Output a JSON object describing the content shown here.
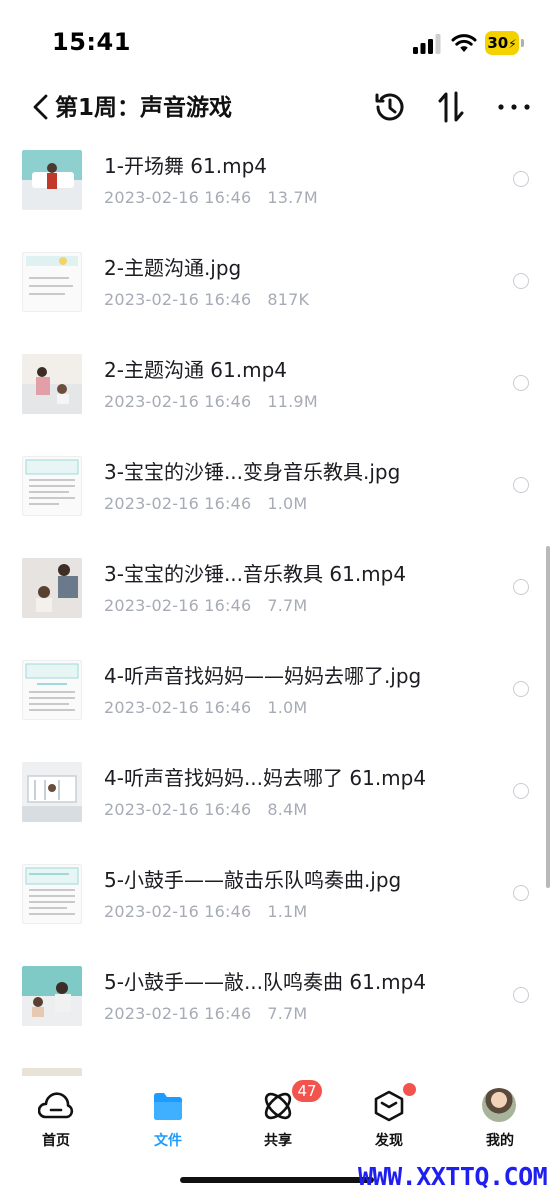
{
  "status_bar": {
    "time": "15:41",
    "battery": "30"
  },
  "nav": {
    "title": "第1周：声音游戏",
    "back_icon": "chevron-left-icon",
    "history_icon": "history-icon",
    "sort_icon": "sort-icon",
    "more_icon": "more-icon"
  },
  "files": [
    {
      "name": "1-开场舞 61.mp4",
      "date": "2023-02-16 16:46",
      "size": "13.7M",
      "kind": "video"
    },
    {
      "name": "2-主题沟通.jpg",
      "date": "2023-02-16 16:46",
      "size": "817K",
      "kind": "doc"
    },
    {
      "name": "2-主题沟通 61.mp4",
      "date": "2023-02-16 16:46",
      "size": "11.9M",
      "kind": "video"
    },
    {
      "name": "3-宝宝的沙锤...变身音乐教具.jpg",
      "date": "2023-02-16 16:46",
      "size": "1.0M",
      "kind": "doc"
    },
    {
      "name": "3-宝宝的沙锤...音乐教具 61.mp4",
      "date": "2023-02-16 16:46",
      "size": "7.7M",
      "kind": "video"
    },
    {
      "name": "4-听声音找妈妈——妈妈去哪了.jpg",
      "date": "2023-02-16 16:46",
      "size": "1.0M",
      "kind": "doc"
    },
    {
      "name": "4-听声音找妈妈...妈去哪了 61.mp4",
      "date": "2023-02-16 16:46",
      "size": "8.4M",
      "kind": "video"
    },
    {
      "name": "5-小鼓手——敲击乐队鸣奏曲.jpg",
      "date": "2023-02-16 16:46",
      "size": "1.1M",
      "kind": "doc"
    },
    {
      "name": "5-小鼓手——敲...队鸣奏曲 61.mp4",
      "date": "2023-02-16 16:46",
      "size": "7.7M",
      "kind": "video"
    }
  ],
  "tab_bar": {
    "tabs": [
      {
        "label": "首页",
        "icon": "cloud-icon"
      },
      {
        "label": "文件",
        "icon": "folder-icon"
      },
      {
        "label": "共享",
        "icon": "share-icon"
      },
      {
        "label": "发现",
        "icon": "box-icon"
      },
      {
        "label": "我的",
        "icon": "avatar"
      }
    ],
    "active_tab": "文件",
    "share_badge": "47"
  },
  "watermark": "WWW.XXTTQ.COM",
  "colors": {
    "accent": "#1e9bff",
    "badge": "#f2544d",
    "meta_text": "#a6abb5",
    "battery": "#f4d200",
    "watermark": "#1f1ff0"
  }
}
